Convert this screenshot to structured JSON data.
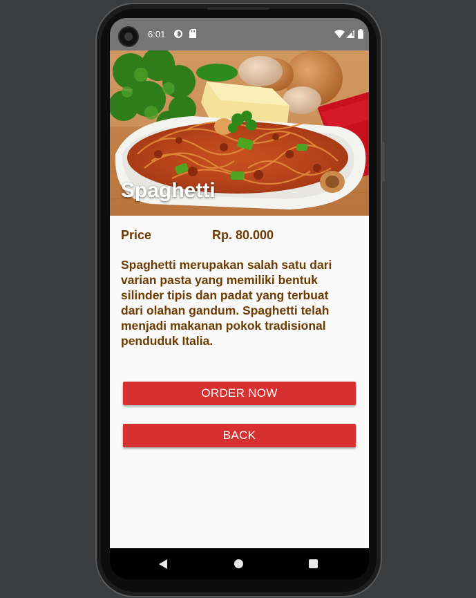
{
  "status_bar": {
    "time": "6:01",
    "icons": [
      "data-saver-icon",
      "sd-card-icon",
      "wifi-icon",
      "signal-icon",
      "battery-icon"
    ]
  },
  "hero": {
    "title": "Spaghetti"
  },
  "price": {
    "label": "Price",
    "value": "Rp. 80.000"
  },
  "description": "Spaghetti merupakan salah satu dari varian pasta yang memiliki bentuk silinder tipis dan padat yang terbuat dari olahan gandum. Spaghetti telah menjadi makanan pokok tradisional penduduk Italia.",
  "buttons": {
    "order_label": "ORDER NOW",
    "back_label": "BACK"
  },
  "nav": {
    "icons": [
      "back-icon",
      "home-icon",
      "recents-icon"
    ]
  },
  "colors": {
    "accent_button": "#d63031",
    "text_brown": "#6d3b00",
    "status_bar": "#757575",
    "background": "#fafafa"
  }
}
